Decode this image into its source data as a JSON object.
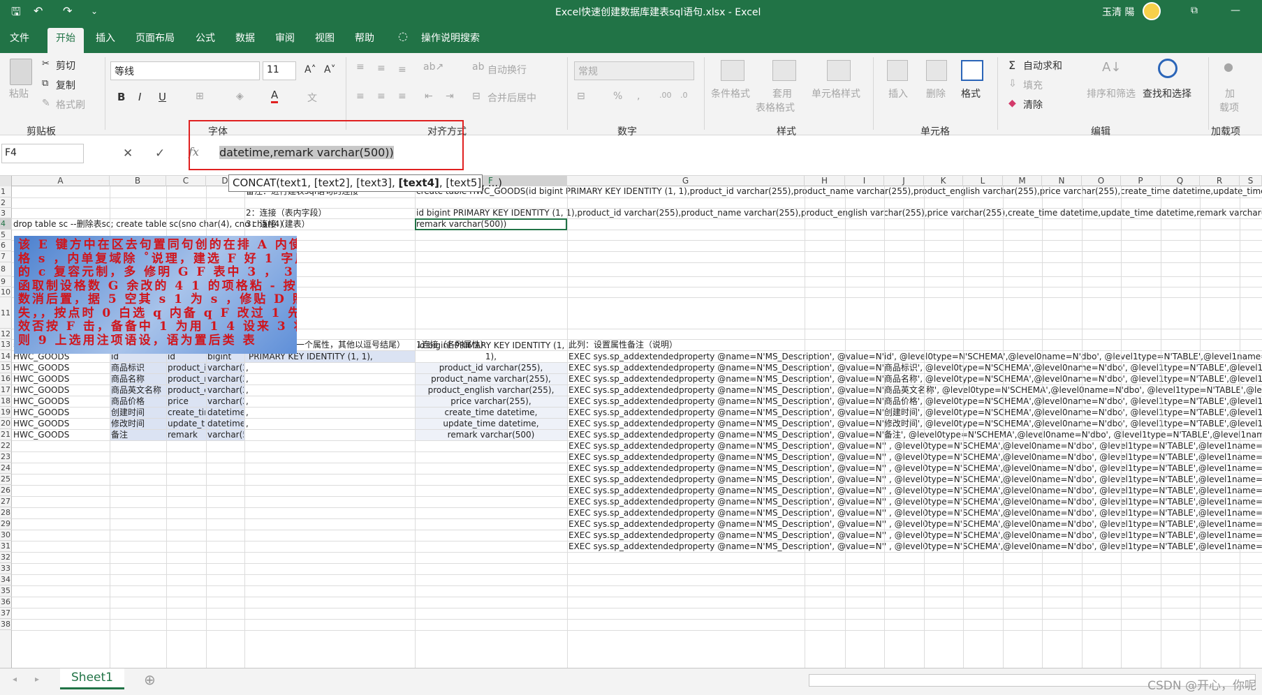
{
  "titlebar": {
    "title": "Excel快速创建数据库建表sql语句.xlsx  -  Excel",
    "user": "玉清 陽",
    "qa_save": "🖫",
    "qa_undo": "↶",
    "qa_redo": "↷",
    "qa_more": "⌄",
    "win_min": "—",
    "win_restore": "⧉",
    "win_ribbon": "▭"
  },
  "tabs": {
    "file": "文件",
    "home": "开始",
    "insert": "插入",
    "layout": "页面布局",
    "formulas": "公式",
    "data": "数据",
    "review": "审阅",
    "view": "视图",
    "help": "帮助",
    "tell": "操作说明搜索"
  },
  "ribbon": {
    "paste": "粘贴",
    "cut": "剪切",
    "copy": "复制",
    "format_painter": "格式刷",
    "clipboard": "剪贴板",
    "font_name": "等线",
    "font_size": "11",
    "bold": "B",
    "italic": "I",
    "underline": "U",
    "font_group": "字体",
    "wrap": "自动换行",
    "merge": "合并后居中",
    "align_group": "对齐方式",
    "number_format": "常规",
    "percent": "%",
    "comma": ",",
    "number_group": "数字",
    "cond_format": "条件格式",
    "table_format_1": "套用",
    "table_format_2": "表格格式",
    "cell_styles": "单元格样式",
    "styles_group": "样式",
    "insert": "插入",
    "delete": "删除",
    "format": "格式",
    "cells_group": "单元格",
    "autosum": "自动求和",
    "fill": "填充",
    "clear": "清除",
    "sort": "排序和筛选",
    "find": "查找和选择",
    "editing_group": "编辑",
    "addin_1": "加",
    "addin_2": "载项",
    "addin_group": "加载项"
  },
  "formula_bar": {
    "name_box": "F4",
    "fx": "fx",
    "content": "datetime,remark varchar(500))",
    "cancel": "✕",
    "enter": "✓"
  },
  "tooltip": {
    "pre": "CONCAT(text1, [text2], [text3], ",
    "bold": "[text4]",
    "post": ", [text5], ...)"
  },
  "columns": [
    "A",
    "B",
    "C",
    "D",
    "E",
    "F",
    "G",
    "H",
    "I",
    "J",
    "K",
    "L",
    "M",
    "N",
    "O",
    "P",
    "Q",
    "R",
    "S"
  ],
  "rows": [
    "1",
    "2",
    "3",
    "4",
    "5",
    "6",
    "7",
    "8",
    "9",
    "10",
    "11",
    "12",
    "13",
    "14",
    "15",
    "16",
    "17",
    "18",
    "19",
    "20",
    "21",
    "22",
    "23",
    "24",
    "25",
    "26",
    "27",
    "28",
    "29",
    "30",
    "31",
    "32",
    "33",
    "34",
    "35",
    "36",
    "37",
    "38"
  ],
  "cells": {
    "e1": "备注：进行建表sql语句的连接",
    "f1": "create table HWC_GOODS(id bigint PRIMARY KEY IDENTITY (1, 1),product_id varchar(255),product_name varchar(255),product_english varchar(255),price varchar(255),create_time datetime,update_time datetime,remark varchar(500))",
    "e3": "2：连接（表内字段）",
    "f3": "id bigint PRIMARY KEY IDENTITY (1, 1),product_id varchar(255),product_name varchar(255),product_english varchar(255),price varchar(255),create_time datetime,update_time datetime,remark varchar(500)",
    "a4": "drop table sc --删除表sc; create table sc(sno char(4), cno char(4)",
    "e4": "3：连接（建表）",
    "f4": "remark varchar(500))",
    "a13": "表名",
    "b13": "列属性说明",
    "c13": "列属性名",
    "d13": "类型",
    "e13": "其他（除最后一个属性，其他以逗号结尾）",
    "f13": "1连接（各列属性）",
    "g13": "此列：设置属性备注（说明）",
    "e14": "PRIMARY KEY IDENTITY (1, 1),",
    "f14a": "id bigint PRIMARY KEY IDENTITY (1,",
    "f14b": "1),",
    "data_rows": [
      {
        "a": "HWC_GOODS",
        "b": "id",
        "c": "id",
        "d": "bigint",
        "e": "",
        "f": "",
        "g": "EXEC sys.sp_addextendedproperty @name=N'MS_Description', @value=N'id', @level0type=N'SCHEMA',@level0name=N'dbo', @level1type=N'TABLE',@level1name=N'HWC_GOODS'"
      },
      {
        "a": "HWC_GOODS",
        "b": "商品标识",
        "c": "product_id",
        "d": "varchar(255)",
        "e": ",",
        "f": "product_id varchar(255),",
        "g": "EXEC sys.sp_addextendedproperty @name=N'MS_Description', @value=N'商品标识', @level0type=N'SCHEMA',@level0name=N'dbo', @level1type=N'TABLE',@level1name=N'HWC_GOODS'"
      },
      {
        "a": "HWC_GOODS",
        "b": "商品名称",
        "c": "product_name",
        "d": "varchar(255)",
        "e": ",",
        "f": "product_name varchar(255),",
        "g": "EXEC sys.sp_addextendedproperty @name=N'MS_Description', @value=N'商品名称', @level0type=N'SCHEMA',@level0name=N'dbo', @level1type=N'TABLE',@level1name=N'HWC_GOODS'"
      },
      {
        "a": "HWC_GOODS",
        "b": "商品英文名称",
        "c": "product_english",
        "d": "varchar(255)",
        "e": ",",
        "f": "product_english varchar(255),",
        "g": "EXEC sys.sp_addextendedproperty @name=N'MS_Description', @value=N'商品英文名称', @level0type=N'SCHEMA',@level0name=N'dbo', @level1type=N'TABLE',@level1name=N'HWC_GOODS'"
      },
      {
        "a": "HWC_GOODS",
        "b": "商品价格",
        "c": "price",
        "d": "varchar(255)",
        "e": ",",
        "f": "price varchar(255),",
        "g": "EXEC sys.sp_addextendedproperty @name=N'MS_Description', @value=N'商品价格', @level0type=N'SCHEMA',@level0name=N'dbo', @level1type=N'TABLE',@level1name=N'HWC_GOODS'"
      },
      {
        "a": "HWC_GOODS",
        "b": "创建时间",
        "c": "create_time",
        "d": "datetime",
        "e": ",",
        "f": "create_time datetime,",
        "g": "EXEC sys.sp_addextendedproperty @name=N'MS_Description', @value=N'创建时间', @level0type=N'SCHEMA',@level0name=N'dbo', @level1type=N'TABLE',@level1name=N'HWC_GOODS'"
      },
      {
        "a": "HWC_GOODS",
        "b": "修改时间",
        "c": "update_time",
        "d": "datetime",
        "e": ",",
        "f": "update_time datetime,",
        "g": "EXEC sys.sp_addextendedproperty @name=N'MS_Description', @value=N'修改时间', @level0type=N'SCHEMA',@level0name=N'dbo', @level1type=N'TABLE',@level1name=N'HWC_GOODS'"
      },
      {
        "a": "HWC_GOODS",
        "b": "备注",
        "c": "remark",
        "d": "varchar(500)",
        "e": "",
        "f": "remark varchar(500)",
        "g": "EXEC sys.sp_addextendedproperty @name=N'MS_Description', @value=N'备注', @level0type=N'SCHEMA',@level0name=N'dbo', @level1type=N'TABLE',@level1name=N'HWC_GOODS'"
      }
    ],
    "g_empty": "EXEC sys.sp_addextendedproperty @name=N'MS_Description', @value=N'' , @level0type=N'SCHEMA',@level0name=N'dbo', @level1type=N'TABLE',@level1name=N'',@level2type=N'COLUMN',@level2name=N''"
  },
  "blue_note": [
    "该 E 键方中在区去句置同句创的在排 A 内使",
    "格 s ，内单复域除 ˚说理，建选 F 好 1 字用",
    "的 c 复容元制，多 修明 G F 表中 3 ， 3 段说",
    "函取制设格数 G 余改的 4 1 的项格粘 - 按明",
    "数消后置，据 5 空其 s 1 为 s ，修贴 D 照：",
    "失，，按点时 0 白选 q 内备 q F 改过 1    先",
    "效否按 F 击，备备中 1 为用 1 4 设来 3    将",
    "    则    9 上选用注项语设，语为置后类    表"
  ],
  "sheet": {
    "tab": "Sheet1",
    "add": "⊕",
    "nav_prev": "◂",
    "nav_next": "▸"
  },
  "watermark": "CSDN @开心，你呢",
  "colors": {
    "accent": "#217346",
    "tooltip_border": "#7a7a7a",
    "annotation": "#e02020",
    "note_text": "#d0151c"
  }
}
